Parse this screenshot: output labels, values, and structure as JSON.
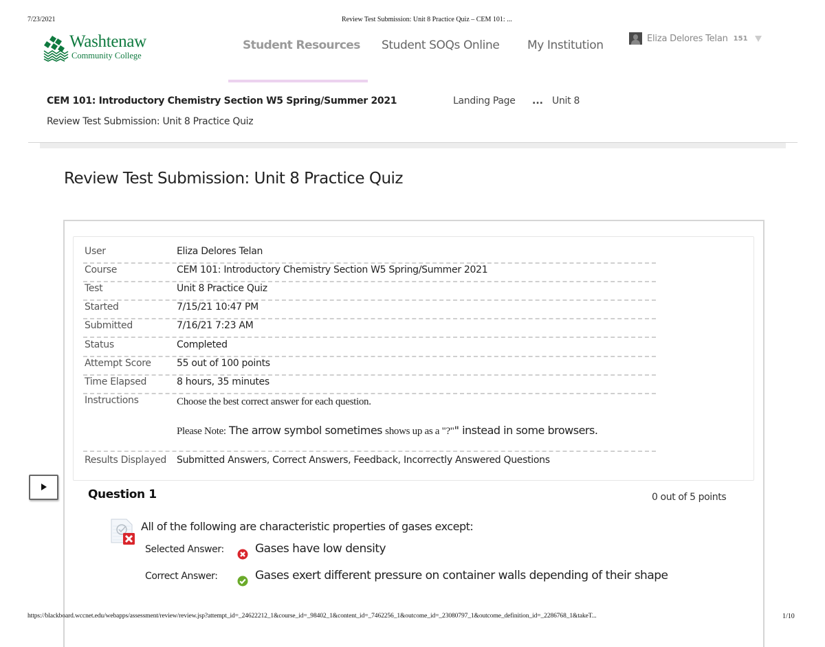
{
  "print_header": {
    "date": "7/23/2021",
    "title": "Review Test Submission: Unit 8 Practice Quiz – CEM 101: ..."
  },
  "print_footer": {
    "url": "https://blackboard.wccnet.edu/webapps/assessment/review/review.jsp?attempt_id=_24622212_1&course_id=_98402_1&content_id=_7462256_1&outcome_id=_23080797_1&outcome_definition_id=_2286768_1&takeT...",
    "page": "1/10"
  },
  "logo": {
    "name": "Washtenaw",
    "subtitle": "Community College",
    "icon": "leaf-logo-icon",
    "color": "#0f7a3f"
  },
  "nav": {
    "items": [
      {
        "label": "Student Resources",
        "active": true
      },
      {
        "label": "Student SOQs Online",
        "active": false
      },
      {
        "label": "My Institution",
        "active": false
      }
    ],
    "active_underline_color": "#ecd2ef"
  },
  "user_menu": {
    "name": "Eliza Delores Telan",
    "badge": "151",
    "avatar_icon": "avatar-icon",
    "caret_icon": "caret-down-icon"
  },
  "course_header": {
    "course_title": "CEM 101: Introductory Chemistry Section W5 Spring/Summer 2021",
    "page_crumb": "Review Test Submission: Unit 8 Practice Quiz",
    "breadcrumbs": [
      "Landing Page",
      "...",
      "Unit 8"
    ]
  },
  "page_title": "Review Test Submission: Unit 8 Practice Quiz",
  "details": {
    "rows": [
      {
        "label": "User",
        "value": "Eliza Delores Telan"
      },
      {
        "label": "Course",
        "value": "CEM 101: Introductory Chemistry Section W5 Spring/Summer 2021"
      },
      {
        "label": "Test",
        "value": "Unit 8 Practice Quiz"
      },
      {
        "label": "Started",
        "value": "7/15/21 10:47 PM"
      },
      {
        "label": "Submitted",
        "value": "7/16/21 7:23 AM"
      },
      {
        "label": "Status",
        "value": "Completed"
      },
      {
        "label": "Attempt Score",
        "value": "55 out of 100 points"
      },
      {
        "label": "Time Elapsed",
        "value": "8 hours, 35 minutes"
      }
    ],
    "instructions": {
      "label": "Instructions",
      "line1": "Choose the best correct answer for each question.",
      "note_prefix": "Please Note:",
      "note_big1": "The arrow symbol sometimes",
      "note_small": "shows up as a \"?\"",
      "note_big2": "\" instead in some browsers."
    },
    "results_displayed": {
      "label": "Results Displayed",
      "value": "Submitted Answers, Correct Answers, Feedback, Incorrectly Answered Questions"
    }
  },
  "expand_button": {
    "icon": "play-triangle-icon"
  },
  "question": {
    "title": "Question 1",
    "points": "0 out of 5 points",
    "status_icon": "incorrect-question-icon",
    "text": "All of the following are characteristic properties of gases except:",
    "selected_label": "Selected Answer:",
    "selected_value": "Gases have low density",
    "selected_icon": "incorrect-x-icon",
    "correct_label": "Correct Answer:",
    "correct_value": "Gases exert different pressure on container walls depending of their shape",
    "correct_icon": "correct-check-icon",
    "incorrect_color": "#d9262c",
    "correct_color": "#6aaa2a"
  }
}
